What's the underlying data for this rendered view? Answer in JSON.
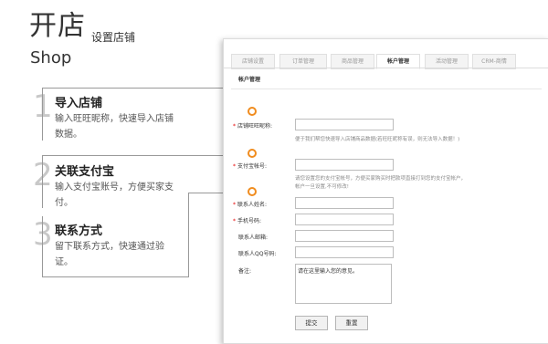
{
  "header": {
    "title": "开店",
    "subtitle": "设置店铺",
    "english": "Shop"
  },
  "steps": [
    {
      "number": "1",
      "title": "导入店铺",
      "desc": "输入旺旺昵称，快速导入店铺数据。"
    },
    {
      "number": "2",
      "title": "关联支付宝",
      "desc": "输入支付宝账号，方便买家支付。"
    },
    {
      "number": "3",
      "title": "联系方式",
      "desc": "留下联系方式，快速通过验证。"
    }
  ],
  "tabs": [
    {
      "label": "店铺设置",
      "active": false
    },
    {
      "label": "订单管理",
      "active": false
    },
    {
      "label": "商品管理",
      "active": false
    },
    {
      "label": "帐户管理",
      "active": true
    },
    {
      "label": "活动管理",
      "active": false
    },
    {
      "label": "CRM-商情",
      "active": false
    }
  ],
  "subnav": "帐户管理",
  "form": {
    "wangwang_label": "店铺旺旺昵称:",
    "wangwang_hint": "便于我们帮您快速导入店铺商品数据(若旺旺昵称有误，则无法导入数据！)",
    "alipay_label": "支付宝帐号:",
    "alipay_hint": "请您设置您的支付宝帐号，方便买家购买时把款项直接打到您的支付宝帐户，帐户一旦设置,不可修改!",
    "contact_label": "联系人姓名:",
    "phone_label": "手机号码:",
    "email_label": "联系人邮箱:",
    "qq_label": "联系人QQ号码:",
    "remark_label": "备注:",
    "remark_placeholder": "请在这里输入您的意见。",
    "submit": "提交",
    "reset": "重置"
  },
  "colors": {
    "accent": "#f08c1e",
    "required": "#e60000"
  }
}
